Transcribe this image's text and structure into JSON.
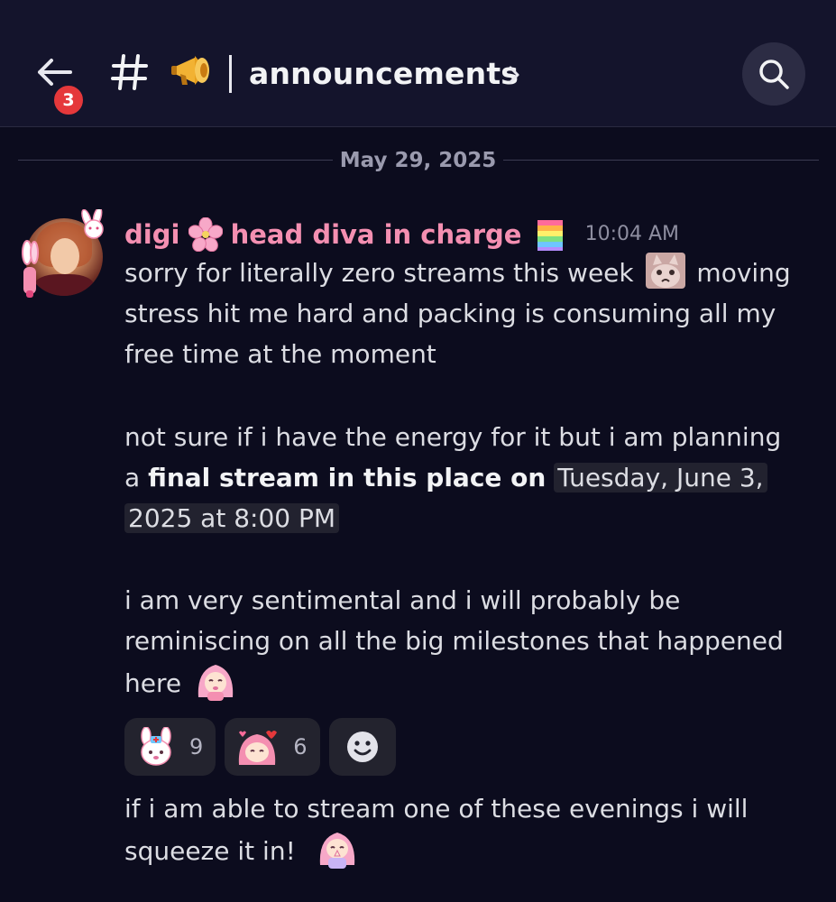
{
  "header": {
    "back_badge_count": "3",
    "channel_name": "announcements"
  },
  "divider": {
    "date": "May 29, 2025"
  },
  "message": {
    "author_part1": "digi",
    "author_part2": "head diva in charge",
    "timestamp": "10:04 AM",
    "line1a": "sorry for literally zero streams this week",
    "line1b": "moving",
    "line2": "stress hit me hard and packing is consuming all my",
    "line3": "free time at the moment",
    "p2_line1": "not sure if i have the energy for it but i am planning",
    "p2_prefix": "a",
    "p2_bold": "final stream in this place on",
    "p2_date1": "Tuesday, June 3,",
    "p2_date2": "2025 at 8:00 PM",
    "p3_line1": "i am very sentimental and i will probably be",
    "p3_line2": "reminiscing on all the big milestones that happened",
    "p3_line3": "here",
    "p4_line1": "if i am able to stream one of these evenings i will",
    "p4_line2": "squeeze it in!"
  },
  "reactions": [
    {
      "emoji": "bunny-nurse-emoji",
      "count": "9"
    },
    {
      "emoji": "pink-character-hearts-emoji",
      "count": "6"
    }
  ],
  "icons": {
    "back": "arrow-left-icon",
    "channel": "hash-icon",
    "megaphone": "megaphone-icon",
    "search": "search-icon",
    "add_reaction": "smiley-add-icon"
  },
  "colors": {
    "author": "#f48fb1",
    "badge": "#e5383b",
    "background": "#0c0c1e",
    "header": "#14142c"
  }
}
